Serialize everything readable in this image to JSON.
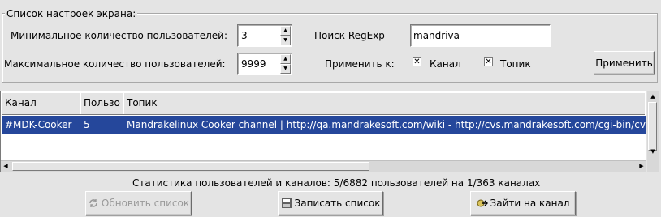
{
  "group": {
    "title": "Список настроек экрана:",
    "min_users_label": "Минимальное количество пользователей:",
    "min_users_value": "3",
    "max_users_label": "Максимальное количество пользователей:",
    "max_users_value": "9999",
    "regexp_label": "Поиск RegExp",
    "regexp_value": "mandriva",
    "apply_to_label": "Применить к:",
    "channel_checkbox_label": "Канал",
    "topic_checkbox_label": "Топик",
    "apply_button": "Применить"
  },
  "table": {
    "columns": [
      "Канал",
      "Пользо",
      "Топик"
    ],
    "rows": [
      {
        "channel": "#MDK-Cooker",
        "users": "5",
        "topic": "Mandrakelinux Cooker channel | http://qa.mandrakesoft.com/wiki - http://cvs.mandrakesoft.com/cgi-bin/cvsweb.cgi"
      }
    ]
  },
  "status_text": "Статистика пользователей и каналов: 5/6882 пользователей  на 1/363 каналах",
  "buttons": {
    "refresh": "Обновить список",
    "save": "Записать список",
    "join": "Зайти на канал"
  },
  "colors": {
    "selection": "#25479b",
    "background": "#e4e4e4"
  }
}
